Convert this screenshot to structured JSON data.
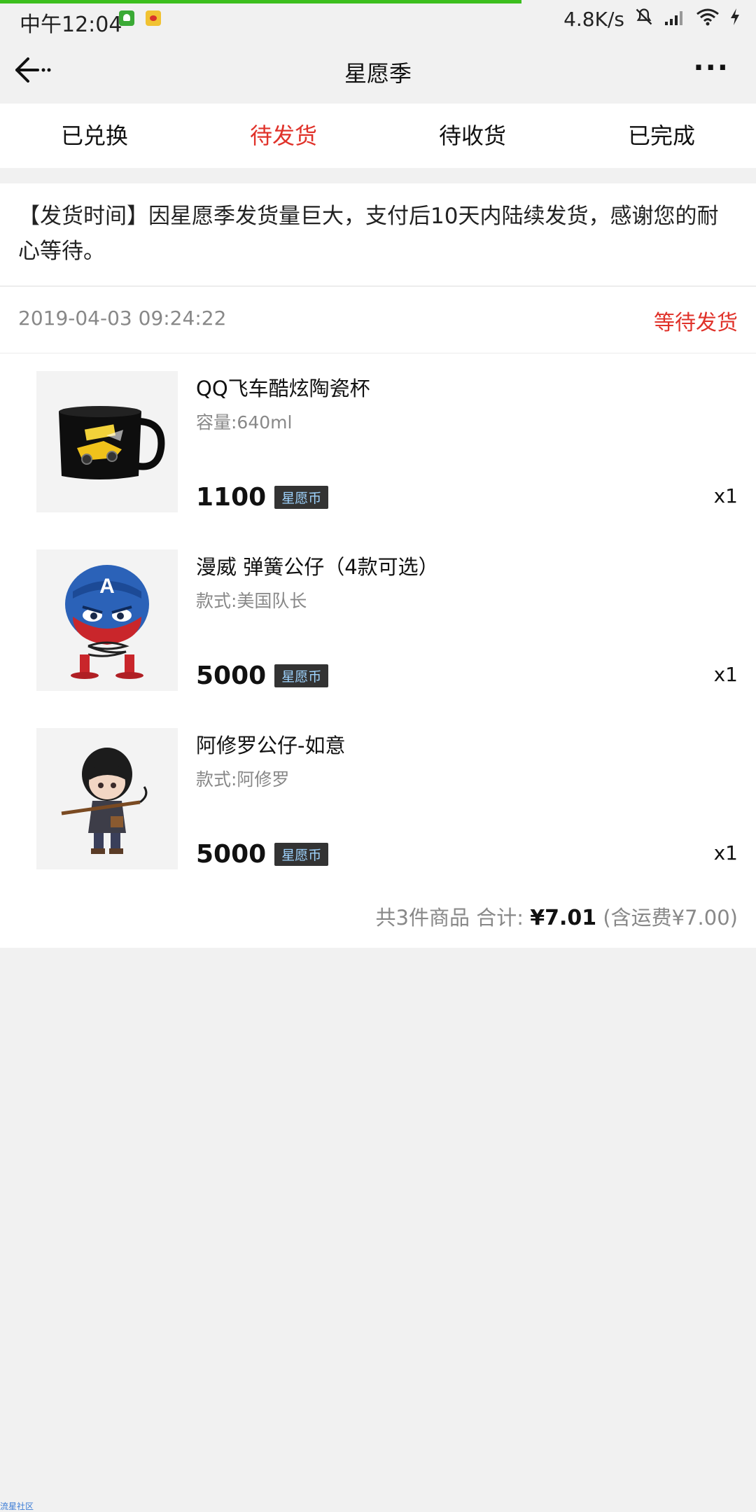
{
  "status_bar": {
    "time": "中午12:04",
    "net_speed": "4.8K/s",
    "icons": [
      "message-app-icon",
      "weibo-app-icon",
      "mute-icon",
      "signal-icon",
      "wifi-icon",
      "charging-icon"
    ]
  },
  "navbar": {
    "title": "星愿季",
    "more": "···"
  },
  "tabs": [
    {
      "label": "已兑换",
      "active": false
    },
    {
      "label": "待发货",
      "active": true
    },
    {
      "label": "待收货",
      "active": false
    },
    {
      "label": "已完成",
      "active": false
    }
  ],
  "notice": {
    "text": "【发货时间】因星愿季发货量巨大，支付后10天内陆续发货，感谢您的耐心等待。"
  },
  "order": {
    "date": "2019-04-03 09:24:22",
    "status": "等待发货",
    "items": [
      {
        "name": "QQ飞车酷炫陶瓷杯",
        "spec": "容量:640ml",
        "price": "1100",
        "currency": "星愿币",
        "qty": "x1"
      },
      {
        "name": "漫威 弹簧公仔（4款可选）",
        "spec": "款式:美国队长",
        "price": "5000",
        "currency": "星愿币",
        "qty": "x1"
      },
      {
        "name": "阿修罗公仔-如意",
        "spec": "款式:阿修罗",
        "price": "5000",
        "currency": "星愿币",
        "qty": "x1"
      }
    ],
    "summary_prefix": "共3件商品 合计:",
    "summary_total": "¥7.01",
    "summary_suffix": "(含运费¥7.00)"
  },
  "watermark": "流星社区",
  "colors": {
    "accent": "#e0322a",
    "loading": "#3cbf1e",
    "coin_badge": "#333333"
  }
}
